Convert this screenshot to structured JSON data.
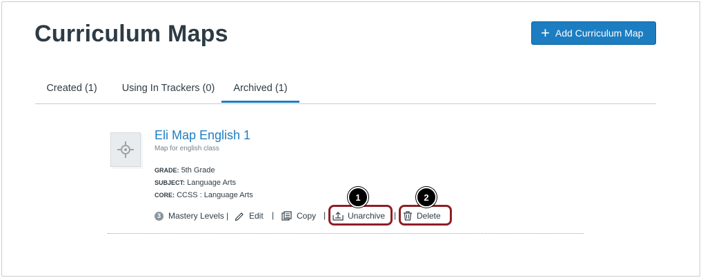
{
  "header": {
    "title": "Curriculum Maps",
    "add_button_label": "Add Curriculum Map"
  },
  "tabs": [
    {
      "label": "Created (1)",
      "active": false
    },
    {
      "label": "Using In Trackers (0)",
      "active": false
    },
    {
      "label": "Archived (1)",
      "active": true
    }
  ],
  "map": {
    "title": "Eli Map English 1",
    "description": "Map for english class",
    "meta": [
      {
        "key": "GRADE:",
        "value": "5th Grade"
      },
      {
        "key": "SUBJECT:",
        "value": "Language Arts"
      },
      {
        "key": "CORE:",
        "value": "CCSS : Language Arts"
      }
    ],
    "mastery_count": "3",
    "mastery_label": "Mastery Levels |",
    "actions": {
      "edit": "Edit",
      "copy": "Copy",
      "unarchive": "Unarchive",
      "delete": "Delete",
      "separator": "|"
    }
  },
  "callouts": [
    "1",
    "2"
  ],
  "colors": {
    "accent": "#1d7dc1",
    "highlight": "#8e1d25",
    "text": "#2d3b45"
  }
}
